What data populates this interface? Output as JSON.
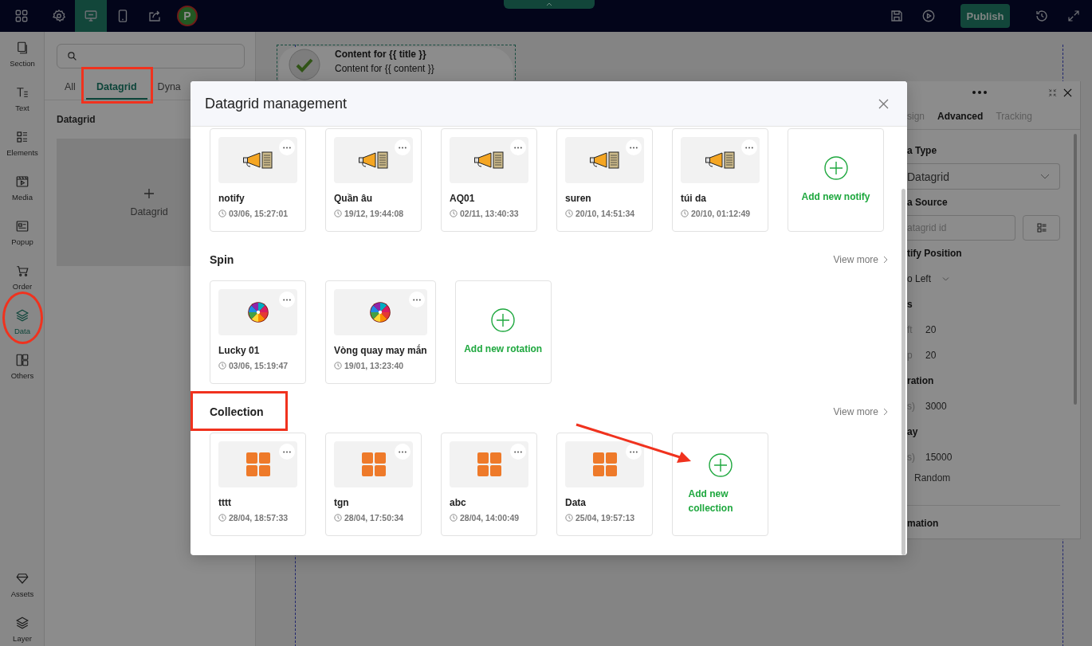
{
  "topbar": {
    "devices": [
      {
        "kind": "desktop",
        "selected": true
      },
      {
        "kind": "mobile",
        "selected": false
      }
    ],
    "avatar": "P",
    "publish": "Publish"
  },
  "sidebar": {
    "items": [
      {
        "kind": "section",
        "label": "Section",
        "selected": false,
        "circled": false
      },
      {
        "kind": "text",
        "label": "Text",
        "selected": false,
        "circled": false
      },
      {
        "kind": "elements",
        "label": "Elements",
        "selected": false,
        "circled": false
      },
      {
        "kind": "media",
        "label": "Media",
        "selected": false,
        "circled": false
      },
      {
        "kind": "popup",
        "label": "Popup",
        "selected": false,
        "circled": false
      },
      {
        "kind": "order",
        "label": "Order",
        "selected": false,
        "circled": false
      },
      {
        "kind": "data",
        "label": "Data",
        "selected": true,
        "circled": true
      },
      {
        "kind": "others",
        "label": "Others",
        "selected": false,
        "circled": false
      }
    ],
    "bottom_items": [
      {
        "kind": "assets",
        "label": "Assets",
        "selected": false,
        "circled": false
      },
      {
        "kind": "layer",
        "label": "Layer",
        "selected": false,
        "circled": false
      }
    ]
  },
  "left_panel": {
    "tabs": [
      {
        "label": "All",
        "selected": false,
        "highlighted": false
      },
      {
        "label": "Datagrid",
        "selected": true,
        "highlighted": true
      },
      {
        "label": "Dyna",
        "selected": false,
        "highlighted": false
      }
    ],
    "heading": "Datagrid",
    "add_tile": "Datagrid"
  },
  "canvas": {
    "card": {
      "title": "Content for {{ title }}",
      "content": "Content for {{ content }}"
    }
  },
  "properties_panel": {
    "tabs": [
      {
        "label": "sign",
        "selected": false
      },
      {
        "label": "Advanced",
        "selected": true
      },
      {
        "label": "Tracking",
        "selected": false
      }
    ],
    "rows": [
      {
        "kind": "heading",
        "text": "a Type"
      },
      {
        "kind": "select",
        "value": "Datagrid"
      },
      {
        "kind": "heading",
        "text": "a Source"
      },
      {
        "kind": "input",
        "placeholder": "atagrid id"
      },
      {
        "kind": "heading",
        "text": "tify Position"
      },
      {
        "kind": "dropdown",
        "value": "o Left"
      },
      {
        "kind": "heading",
        "text": "s"
      },
      {
        "kind": "pair",
        "label": "ft",
        "value": "20"
      },
      {
        "kind": "pair",
        "label": "p",
        "value": "20"
      },
      {
        "kind": "heading",
        "text": "ration"
      },
      {
        "kind": "pair",
        "label": "s)",
        "value": "3000"
      },
      {
        "kind": "heading",
        "text": "ay"
      },
      {
        "kind": "pair",
        "label": "s)",
        "value": "15000"
      },
      {
        "kind": "option",
        "text": "Random"
      },
      {
        "kind": "section",
        "text": "mation"
      }
    ]
  },
  "modal": {
    "title": "Datagrid management",
    "sections": [
      {
        "kind": "notify",
        "highlighted": false,
        "add_label": "Add new notify",
        "add_arrow": false,
        "items": [
          {
            "name": "notify",
            "date": "03/06, 15:27:01"
          },
          {
            "name": "Quần âu",
            "date": "19/12, 19:44:08"
          },
          {
            "name": "AQ01",
            "date": "02/11, 13:40:33"
          },
          {
            "name": "suren",
            "date": "20/10, 14:51:34"
          },
          {
            "name": "túi da",
            "date": "20/10, 01:12:49"
          }
        ]
      },
      {
        "kind": "spin",
        "title": "Spin",
        "view_more": "View more",
        "highlighted": false,
        "add_label": "Add new rotation",
        "add_arrow": false,
        "items": [
          {
            "name": "Lucky 01",
            "date": "03/06, 15:19:47"
          },
          {
            "name": "Vòng quay may mắn",
            "date": "19/01, 13:23:40"
          }
        ]
      },
      {
        "kind": "collection",
        "title": "Collection",
        "view_more": "View more",
        "highlighted": true,
        "add_label": "Add new collection",
        "add_arrow": true,
        "items": [
          {
            "name": "tttt",
            "date": "28/04, 18:57:33"
          },
          {
            "name": "tgn",
            "date": "28/04, 17:50:34"
          },
          {
            "name": "abc",
            "date": "28/04, 14:00:49"
          },
          {
            "name": "Data",
            "date": "25/04, 19:57:13"
          }
        ]
      }
    ]
  }
}
